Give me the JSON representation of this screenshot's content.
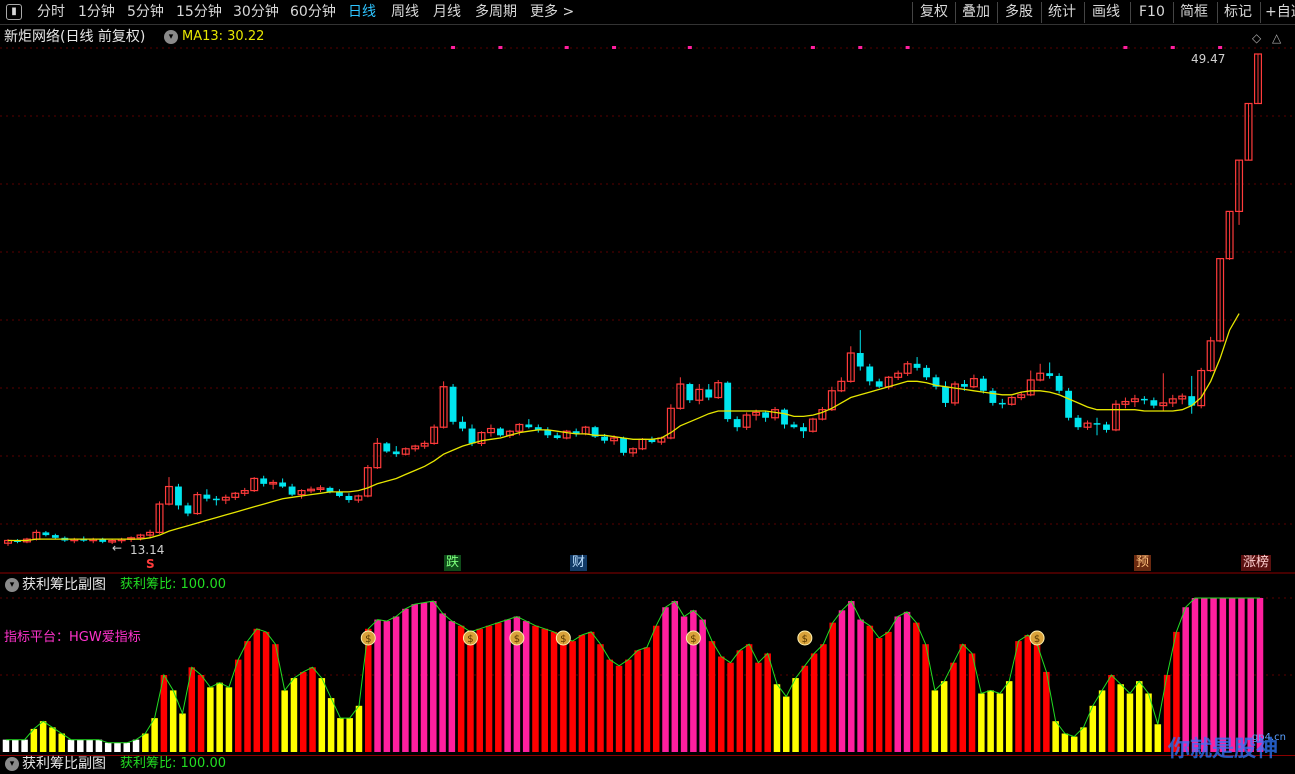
{
  "toolbar": {
    "left_items": [
      "分时",
      "1分钟",
      "5分钟",
      "15分钟",
      "30分钟",
      "60分钟",
      "日线",
      "周线",
      "月线",
      "多周期",
      "更多 >"
    ],
    "active_item": "日线",
    "right_items": [
      "复权",
      "叠加",
      "多股",
      "统计",
      "画线",
      "F10",
      "简框",
      "标记",
      "+自选"
    ]
  },
  "header": {
    "stock_title": "新炬网络(日线 前复权)",
    "ma_label": "MA13: 30.22"
  },
  "main_chart": {
    "high_label": "49.47",
    "low_label": "13.14",
    "markers": {
      "s_marker": "S",
      "die": "跌",
      "cai": "财",
      "yu": "预",
      "zhangbang": "涨榜"
    }
  },
  "sub_chart": {
    "title": "获利筹比副图",
    "value_label": "获利筹比: 100.00",
    "platform_label": "指标平台：HGW爱指标"
  },
  "sub_chart2": {
    "title": "获利筹比副图",
    "value_label": "获利筹比: 100.00"
  },
  "watermark": {
    "text": "你就是股神",
    "site": "gp4.cn"
  },
  "colors": {
    "up": "#ff3b3b",
    "down": "#00e5ee",
    "ma": "#e6e600",
    "magenta": "#ff1f9f",
    "red_bar": "#ff0000",
    "yellow_bar": "#ffff00",
    "white_bar": "#ffffff",
    "accent": "#2ec4ff"
  },
  "chart_data": [
    {
      "type": "candlestick",
      "title": "新炬网络(日线 前复权)",
      "series": [
        {
          "name": "MA13",
          "type": "line",
          "note": "MA13: 30.22"
        }
      ],
      "ylim": [
        13.14,
        49.47
      ],
      "values": [
        [
          13.2,
          13.5,
          13.0,
          13.4
        ],
        [
          13.4,
          13.5,
          13.2,
          13.3
        ],
        [
          13.3,
          13.6,
          13.2,
          13.5
        ],
        [
          13.5,
          14.2,
          13.4,
          14.0
        ],
        [
          14.0,
          14.1,
          13.7,
          13.8
        ],
        [
          13.8,
          13.9,
          13.5,
          13.6
        ],
        [
          13.6,
          13.7,
          13.3,
          13.4
        ],
        [
          13.4,
          13.6,
          13.2,
          13.5
        ],
        [
          13.5,
          13.7,
          13.3,
          13.4
        ],
        [
          13.4,
          13.6,
          13.2,
          13.5
        ],
        [
          13.5,
          13.6,
          13.2,
          13.3
        ],
        [
          13.3,
          13.5,
          13.14,
          13.4
        ],
        [
          13.4,
          13.6,
          13.2,
          13.5
        ],
        [
          13.5,
          13.7,
          13.3,
          13.6
        ],
        [
          13.6,
          13.9,
          13.4,
          13.8
        ],
        [
          13.8,
          14.2,
          13.6,
          14.0
        ],
        [
          14.0,
          16.3,
          13.9,
          16.1
        ],
        [
          16.1,
          18.1,
          16.0,
          17.4
        ],
        [
          17.4,
          17.6,
          15.7,
          16.0
        ],
        [
          16.0,
          16.2,
          15.2,
          15.4
        ],
        [
          15.4,
          17.0,
          15.3,
          16.8
        ],
        [
          16.8,
          17.2,
          16.3,
          16.5
        ],
        [
          16.5,
          16.7,
          16.0,
          16.4
        ],
        [
          16.4,
          16.8,
          16.1,
          16.6
        ],
        [
          16.6,
          17.0,
          16.4,
          16.9
        ],
        [
          16.9,
          17.3,
          16.7,
          17.1
        ],
        [
          17.1,
          18.1,
          17.0,
          18.0
        ],
        [
          18.0,
          18.2,
          17.4,
          17.6
        ],
        [
          17.6,
          17.9,
          17.2,
          17.7
        ],
        [
          17.7,
          18.0,
          17.3,
          17.4
        ],
        [
          17.4,
          17.6,
          16.7,
          16.8
        ],
        [
          16.8,
          17.2,
          16.5,
          17.1
        ],
        [
          17.1,
          17.4,
          16.9,
          17.2
        ],
        [
          17.2,
          17.5,
          17.0,
          17.3
        ],
        [
          17.3,
          17.4,
          16.9,
          17.0
        ],
        [
          17.0,
          17.2,
          16.6,
          16.7
        ],
        [
          16.7,
          16.9,
          16.2,
          16.4
        ],
        [
          16.4,
          16.8,
          16.2,
          16.7
        ],
        [
          16.7,
          19.0,
          16.6,
          18.8
        ],
        [
          18.8,
          21.0,
          18.7,
          20.6
        ],
        [
          20.6,
          20.7,
          19.9,
          20.0
        ],
        [
          20.0,
          20.4,
          19.6,
          19.8
        ],
        [
          19.8,
          20.3,
          19.7,
          20.2
        ],
        [
          20.2,
          20.5,
          20.0,
          20.4
        ],
        [
          20.4,
          20.8,
          20.2,
          20.6
        ],
        [
          20.6,
          22.0,
          20.5,
          21.8
        ],
        [
          21.8,
          25.2,
          21.7,
          24.8
        ],
        [
          24.8,
          25.0,
          22.0,
          22.2
        ],
        [
          22.2,
          22.6,
          21.5,
          21.7
        ],
        [
          21.7,
          22.0,
          20.4,
          20.6
        ],
        [
          20.6,
          21.5,
          20.4,
          21.4
        ],
        [
          21.4,
          22.0,
          21.1,
          21.7
        ],
        [
          21.7,
          21.8,
          21.1,
          21.2
        ],
        [
          21.2,
          21.6,
          21.0,
          21.5
        ],
        [
          21.5,
          22.1,
          21.2,
          22.0
        ],
        [
          22.0,
          22.4,
          21.7,
          21.8
        ],
        [
          21.8,
          22.0,
          21.4,
          21.6
        ],
        [
          21.6,
          21.8,
          21.0,
          21.2
        ],
        [
          21.2,
          21.4,
          20.9,
          21.0
        ],
        [
          21.0,
          21.6,
          20.9,
          21.5
        ],
        [
          21.5,
          21.7,
          21.1,
          21.3
        ],
        [
          21.3,
          21.9,
          21.2,
          21.8
        ],
        [
          21.8,
          21.9,
          21.0,
          21.1
        ],
        [
          21.1,
          21.3,
          20.6,
          20.8
        ],
        [
          20.8,
          21.2,
          20.5,
          21.0
        ],
        [
          21.0,
          21.1,
          19.7,
          19.9
        ],
        [
          19.9,
          20.3,
          19.6,
          20.2
        ],
        [
          20.2,
          21.0,
          20.1,
          20.9
        ],
        [
          20.9,
          21.1,
          20.6,
          20.7
        ],
        [
          20.7,
          21.1,
          20.5,
          21.0
        ],
        [
          21.0,
          23.5,
          20.9,
          23.2
        ],
        [
          23.2,
          25.5,
          23.1,
          25.0
        ],
        [
          25.0,
          25.1,
          23.6,
          23.8
        ],
        [
          23.8,
          25.0,
          23.5,
          24.6
        ],
        [
          24.6,
          25.0,
          23.8,
          24.0
        ],
        [
          24.0,
          25.3,
          23.9,
          25.1
        ],
        [
          25.1,
          25.2,
          22.2,
          22.4
        ],
        [
          22.4,
          22.6,
          21.5,
          21.8
        ],
        [
          21.8,
          22.9,
          21.6,
          22.7
        ],
        [
          22.7,
          23.1,
          22.3,
          22.9
        ],
        [
          22.9,
          23.0,
          22.2,
          22.5
        ],
        [
          22.5,
          23.3,
          22.3,
          23.1
        ],
        [
          23.1,
          23.2,
          21.7,
          22.0
        ],
        [
          22.0,
          22.2,
          21.7,
          21.8
        ],
        [
          21.8,
          22.1,
          21.0,
          21.5
        ],
        [
          21.5,
          22.5,
          21.4,
          22.4
        ],
        [
          22.4,
          23.3,
          22.3,
          23.1
        ],
        [
          23.1,
          24.8,
          23.0,
          24.5
        ],
        [
          24.5,
          25.5,
          24.4,
          25.2
        ],
        [
          25.2,
          27.8,
          25.1,
          27.3
        ],
        [
          27.3,
          29.0,
          26.0,
          26.3
        ],
        [
          26.3,
          26.5,
          24.9,
          25.2
        ],
        [
          25.2,
          25.4,
          24.7,
          24.8
        ],
        [
          24.8,
          25.6,
          24.6,
          25.5
        ],
        [
          25.5,
          26.0,
          25.3,
          25.8
        ],
        [
          25.8,
          26.7,
          25.6,
          26.5
        ],
        [
          26.5,
          27.0,
          26.0,
          26.2
        ],
        [
          26.2,
          26.4,
          25.3,
          25.5
        ],
        [
          25.5,
          25.7,
          24.6,
          24.8
        ],
        [
          24.8,
          25.2,
          23.3,
          23.6
        ],
        [
          23.6,
          25.2,
          23.4,
          25.0
        ],
        [
          25.0,
          25.3,
          24.5,
          24.8
        ],
        [
          24.8,
          25.7,
          24.7,
          25.4
        ],
        [
          25.4,
          25.6,
          24.3,
          24.5
        ],
        [
          24.5,
          24.7,
          23.4,
          23.6
        ],
        [
          23.6,
          23.9,
          23.2,
          23.5
        ],
        [
          23.5,
          24.1,
          23.4,
          24.0
        ],
        [
          24.0,
          24.4,
          23.8,
          24.2
        ],
        [
          24.2,
          26.0,
          24.1,
          25.3
        ],
        [
          25.3,
          26.5,
          25.2,
          25.8
        ],
        [
          25.8,
          26.6,
          25.4,
          25.6
        ],
        [
          25.6,
          25.8,
          24.3,
          24.5
        ],
        [
          24.5,
          24.7,
          22.3,
          22.5
        ],
        [
          22.5,
          22.7,
          21.6,
          21.8
        ],
        [
          21.8,
          22.3,
          21.6,
          22.1
        ],
        [
          22.1,
          22.5,
          21.2,
          22.0
        ],
        [
          22.0,
          22.2,
          21.4,
          21.6
        ],
        [
          21.6,
          23.8,
          21.5,
          23.5
        ],
        [
          23.5,
          24.0,
          23.2,
          23.7
        ],
        [
          23.7,
          24.2,
          23.3,
          23.9
        ],
        [
          23.9,
          24.1,
          23.5,
          23.8
        ],
        [
          23.8,
          24.0,
          23.2,
          23.4
        ],
        [
          23.4,
          25.8,
          23.0,
          23.6
        ],
        [
          23.6,
          24.2,
          23.3,
          23.9
        ],
        [
          23.9,
          24.3,
          23.5,
          24.1
        ],
        [
          24.1,
          25.6,
          22.8,
          23.4
        ],
        [
          23.4,
          26.2,
          23.2,
          26.0
        ],
        [
          26.0,
          28.5,
          25.9,
          28.2
        ],
        [
          28.2,
          34.3,
          28.1,
          34.3
        ],
        [
          34.3,
          37.8,
          34.2,
          37.8
        ],
        [
          37.8,
          41.6,
          36.8,
          41.6
        ],
        [
          41.6,
          45.8,
          41.6,
          45.8
        ],
        [
          45.8,
          49.47,
          45.8,
          49.47
        ]
      ],
      "ma13_estimated": [
        13.4,
        13.4,
        13.4,
        13.5,
        13.5,
        13.5,
        13.5,
        13.5,
        13.5,
        13.5,
        13.5,
        13.5,
        13.5,
        13.5,
        13.5,
        13.6,
        13.8,
        14.1,
        14.3,
        14.5,
        14.7,
        14.9,
        15.1,
        15.3,
        15.5,
        15.7,
        15.9,
        16.1,
        16.3,
        16.5,
        16.6,
        16.7,
        16.8,
        16.9,
        17.0,
        17.0,
        17.0,
        17.1,
        17.3,
        17.6,
        17.8,
        18.0,
        18.3,
        18.6,
        18.9,
        19.3,
        19.8,
        20.1,
        20.4,
        20.6,
        20.8,
        20.9,
        21.0,
        21.2,
        21.4,
        21.5,
        21.6,
        21.6,
        21.5,
        21.4,
        21.3,
        21.3,
        21.2,
        21.2,
        21.1,
        21.0,
        20.9,
        20.9,
        20.9,
        21.0,
        21.4,
        21.9,
        22.2,
        22.5,
        22.8,
        23.0,
        23.0,
        23.0,
        23.0,
        23.0,
        23.0,
        22.9,
        22.8,
        22.6,
        22.6,
        22.7,
        22.9,
        23.2,
        23.6,
        24.0,
        24.2,
        24.4,
        24.6,
        24.8,
        25.0,
        25.2,
        25.2,
        25.1,
        24.9,
        24.8,
        24.7,
        24.6,
        24.5,
        24.4,
        24.3,
        24.2,
        24.2,
        24.4,
        24.5,
        24.5,
        24.4,
        24.2,
        23.9,
        23.6,
        23.3,
        23.1,
        23.1,
        23.1,
        23.1,
        23.1,
        23.0,
        23.0,
        23.0,
        23.0,
        23.1,
        23.4,
        24.0,
        25.2,
        26.9,
        29.0,
        30.22
      ]
    },
    {
      "type": "bar",
      "title": "获利筹比副图",
      "ylim": [
        0,
        100
      ],
      "values": [
        8,
        8,
        8,
        15,
        20,
        16,
        12,
        8,
        8,
        8,
        8,
        6,
        6,
        6,
        8,
        12,
        22,
        50,
        40,
        25,
        55,
        50,
        42,
        45,
        42,
        60,
        72,
        80,
        78,
        70,
        40,
        48,
        52,
        55,
        48,
        35,
        22,
        22,
        30,
        80,
        86,
        85,
        88,
        93,
        96,
        97,
        98,
        90,
        85,
        82,
        78,
        80,
        82,
        84,
        86,
        88,
        85,
        82,
        80,
        78,
        74,
        72,
        76,
        78,
        70,
        60,
        56,
        60,
        66,
        68,
        82,
        94,
        98,
        88,
        92,
        86,
        72,
        62,
        58,
        66,
        70,
        58,
        64,
        44,
        36,
        48,
        56,
        64,
        70,
        84,
        92,
        98,
        86,
        82,
        74,
        78,
        88,
        91,
        84,
        70,
        40,
        46,
        58,
        70,
        64,
        38,
        40,
        38,
        46,
        72,
        76,
        70,
        52,
        20,
        12,
        10,
        16,
        30,
        40,
        50,
        44,
        38,
        46,
        38,
        18,
        50,
        78,
        94,
        100,
        100,
        100,
        100,
        100,
        100,
        100,
        100
      ],
      "colors_by_bar": "white<10, yellow<50, red<85, magenta>=85 (estimated)"
    }
  ]
}
